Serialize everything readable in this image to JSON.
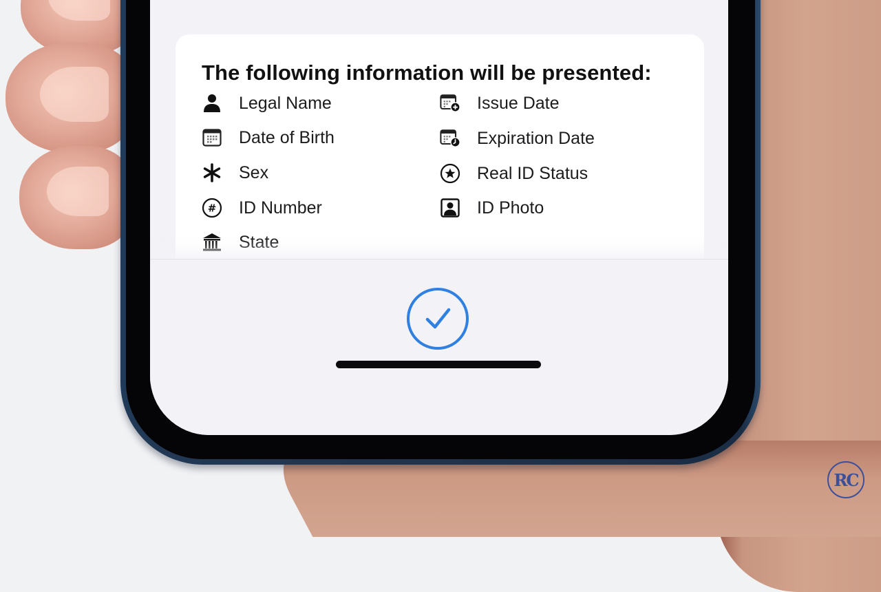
{
  "card": {
    "title": "The following information will be presented:",
    "left_items": [
      {
        "label": "Legal Name",
        "icon": "person-icon"
      },
      {
        "label": "Date of Birth",
        "icon": "calendar-icon"
      },
      {
        "label": "Sex",
        "icon": "asterisk-icon"
      },
      {
        "label": "ID Number",
        "icon": "number-circle-icon"
      },
      {
        "label": "State",
        "icon": "building-columns-icon"
      }
    ],
    "right_items": [
      {
        "label": "Issue Date",
        "icon": "calendar-plus-icon"
      },
      {
        "label": "Expiration Date",
        "icon": "calendar-clock-icon"
      },
      {
        "label": "Real ID Status",
        "icon": "star-circle-icon"
      },
      {
        "label": "ID Photo",
        "icon": "person-square-icon"
      }
    ]
  },
  "confirm": {
    "icon": "checkmark-circle-icon",
    "accent_color": "#2f80e0"
  },
  "watermark": {
    "text": "RC",
    "color": "#3b4f9a"
  }
}
